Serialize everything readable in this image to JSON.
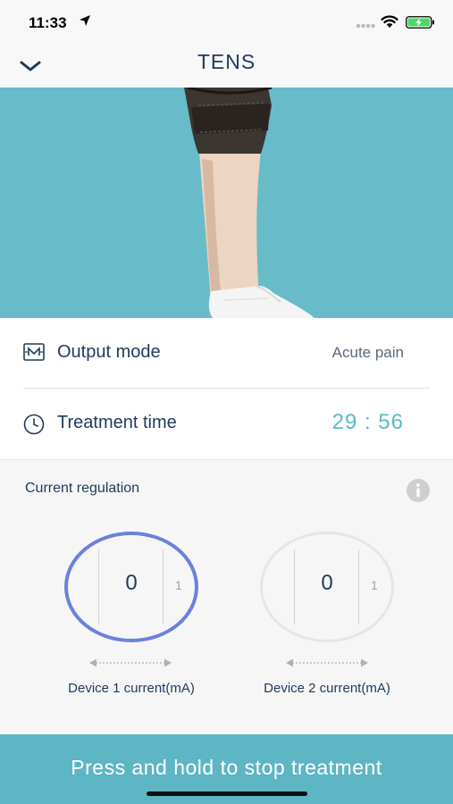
{
  "status_bar": {
    "time": "11:33",
    "icons": [
      "location-arrow-icon",
      "signal-dots-icon",
      "wifi-icon",
      "battery-charging-icon"
    ],
    "battery_color": "#4cd964"
  },
  "nav": {
    "title": "TENS",
    "back_icon": "chevron-down-icon"
  },
  "hero": {
    "image": "knee-brace-photo",
    "background_color": "#68bcc9"
  },
  "settings": {
    "output_mode": {
      "icon": "mode-m-icon",
      "label": "Output mode",
      "value": "Acute pain"
    },
    "treatment_time": {
      "icon": "clock-icon",
      "label": "Treatment time",
      "value": "29 : 56"
    }
  },
  "regulation": {
    "title": "Current regulation",
    "info_icon": "info-icon",
    "devices": [
      {
        "current": "0",
        "next": "1",
        "label": "Device 1 current(mA)",
        "active": true
      },
      {
        "current": "0",
        "next": "1",
        "label": "Device 2 current(mA)",
        "active": false
      }
    ],
    "active_color": "#6a82dc"
  },
  "action": {
    "label": "Press and hold to stop treatment",
    "color": "#5eb5c3"
  }
}
